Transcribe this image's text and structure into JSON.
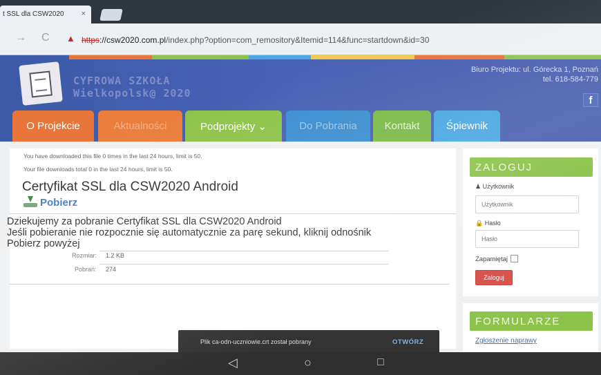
{
  "browser": {
    "tab_title": "t SSL dla CSW2020",
    "tab_close": "×",
    "url_scheme": "https",
    "url_host": "://csw2020.com.pl",
    "url_path": "/index.php?option=com_remository&Itemid=114&func=startdown&id=30",
    "back_icon": "→",
    "reload_icon": "C",
    "warning_icon": "▲"
  },
  "site": {
    "logo_line1": "CYFROWA SZKOŁA",
    "logo_line2": "Wielkopolsk@ 2020",
    "contact_line1": "Biuro Projektu: ul. Górecka 1, Poznań",
    "contact_line2": "tel. 618-584-779",
    "facebook_label": "f"
  },
  "menu": [
    {
      "label": "O Projekcie",
      "color": "#e8753a"
    },
    {
      "label": "Aktualności",
      "color": "#ea7f3d"
    },
    {
      "label": "Podprojekty  ⌄",
      "color": "#8fc44c"
    },
    {
      "label": "Do Pobrania",
      "color": "#3d8fd0"
    },
    {
      "label": "Kontakt",
      "color": "#7cba4a"
    },
    {
      "label": "Śpiewnik",
      "color": "#4aa7e3"
    }
  ],
  "content": {
    "note1": "You have downloaded this file 0 times in the last 24 hours, limit is 50.",
    "note2": "Your file downloads total 0 in the last 24 hours, limit is 50.",
    "title": "Certyfikat SSL dla CSW2020 Android",
    "download_label": "Pobierz",
    "thanks_line1": "Dziekujemy za pobranie Certyfikat SSL dla CSW2020 Android",
    "thanks_line2": "Jeśli pobieranie nie rozpocznie się automatycznie za parę sekund, kliknij odnośnik",
    "thanks_line3": "Pobierz powyżej",
    "size_label": "Rozmiar:",
    "size_value": "1.2 KB",
    "downloads_label": "Pobrań:",
    "downloads_value": "274"
  },
  "login": {
    "header": "ZALOGUJ",
    "user_label": "Użytkownik",
    "user_placeholder": "Użytkownik",
    "password_label": "Hasło",
    "password_placeholder": "Hasło",
    "remember_label": "Zapamiętaj",
    "button": "Zaloguj"
  },
  "forms": {
    "header": "FORMULARZE",
    "link": "Zgłoszenie naprawy"
  },
  "toast": {
    "text": "Plik ca-odn-uczniowie.crt został pobrany",
    "action": "OTWÓRZ"
  },
  "android_nav": {
    "back": "◁",
    "home": "○",
    "recents": "□"
  }
}
